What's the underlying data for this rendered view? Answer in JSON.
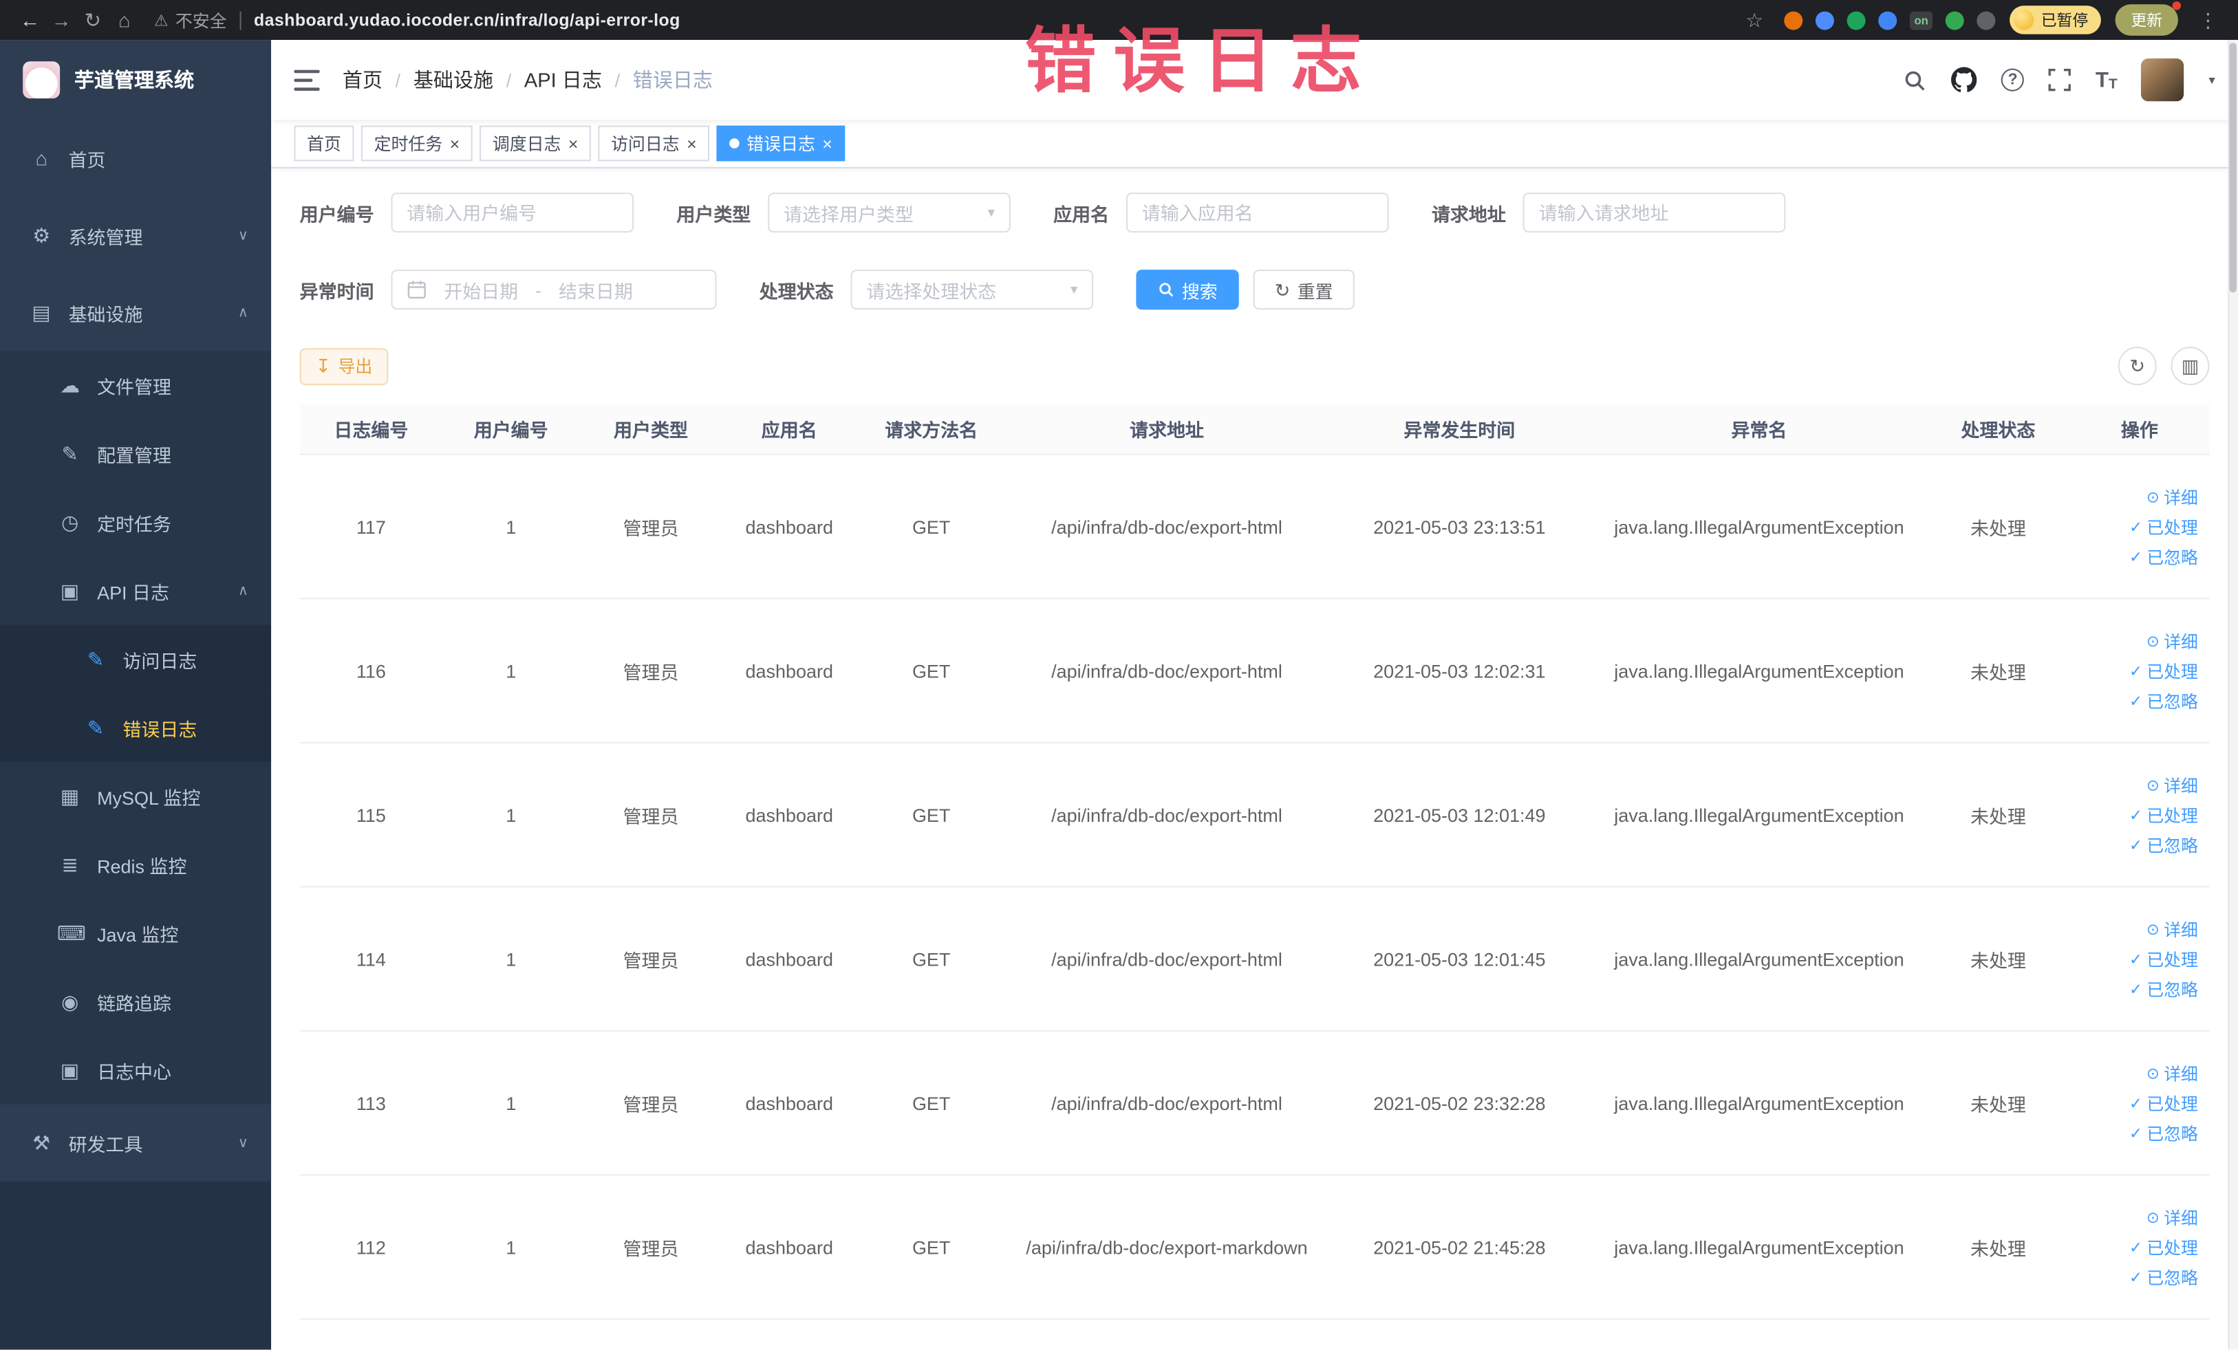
{
  "browser": {
    "security_label": "不安全",
    "url": "dashboard.yudao.iocoder.cn/infra/log/api-error-log",
    "paused_badge": "已暂停",
    "update_button": "更新",
    "extensions": [
      {
        "name": "extension-orange-icon",
        "color": "#e8710a"
      },
      {
        "name": "extension-blue-drop-icon",
        "color": "#4e8cff"
      },
      {
        "name": "extension-green-circle-icon",
        "color": "#1ea45c"
      },
      {
        "name": "extension-blue-grid-icon",
        "color": "#4285f4"
      },
      {
        "name": "extension-on-badge",
        "color": "#3c4043",
        "label": "on"
      },
      {
        "name": "extension-green-leaf-icon",
        "color": "#34a853"
      },
      {
        "name": "extension-pin-icon",
        "color": "#5f6368"
      }
    ]
  },
  "annotation": {
    "text": "错误日志",
    "color": "#ed4c67"
  },
  "theme": {
    "accent": "#409eff",
    "active_menu_text": "#ffd04b",
    "warning": "#e6a23c",
    "sidebar_bg": "#2e3d52"
  },
  "sidebar": {
    "logo_title": "芋道管理系统",
    "items": [
      {
        "label": "首页",
        "icon": "home-icon",
        "level": 0
      },
      {
        "label": "系统管理",
        "icon": "gear-icon",
        "level": 0,
        "chevron": "down"
      },
      {
        "label": "基础设施",
        "icon": "infrastructure-icon",
        "level": 0,
        "chevron": "up"
      },
      {
        "label": "文件管理",
        "icon": "file-icon",
        "level": 1
      },
      {
        "label": "配置管理",
        "icon": "config-icon",
        "level": 1
      },
      {
        "label": "定时任务",
        "icon": "timer-icon",
        "level": 1
      },
      {
        "label": "API 日志",
        "icon": "api-log-icon",
        "level": 1,
        "chevron": "up"
      },
      {
        "label": "访问日志",
        "icon": "access-log-icon",
        "level": 2,
        "icon_color": "#409eff"
      },
      {
        "label": "错误日志",
        "icon": "error-log-icon",
        "level": 2,
        "icon_color": "#409eff",
        "active": true
      },
      {
        "label": "MySQL 监控",
        "icon": "mysql-icon",
        "level": 1
      },
      {
        "label": "Redis 监控",
        "icon": "redis-icon",
        "level": 1
      },
      {
        "label": "Java 监控",
        "icon": "java-icon",
        "level": 1
      },
      {
        "label": "链路追踪",
        "icon": "trace-icon",
        "level": 1
      },
      {
        "label": "日志中心",
        "icon": "log-center-icon",
        "level": 1
      },
      {
        "label": "研发工具",
        "icon": "devtools-icon",
        "level": 0,
        "chevron": "down"
      }
    ]
  },
  "header": {
    "breadcrumb": [
      {
        "label": "首页"
      },
      {
        "label": "基础设施"
      },
      {
        "label": "API 日志"
      },
      {
        "label": "错误日志",
        "current": true
      }
    ]
  },
  "tabs": [
    {
      "label": "首页",
      "closable": false,
      "active": false
    },
    {
      "label": "定时任务",
      "closable": true,
      "active": false
    },
    {
      "label": "调度日志",
      "closable": true,
      "active": false
    },
    {
      "label": "访问日志",
      "closable": true,
      "active": false
    },
    {
      "label": "错误日志",
      "closable": true,
      "active": true
    }
  ],
  "filters": {
    "user_id": {
      "label": "用户编号",
      "placeholder": "请输入用户编号"
    },
    "user_type": {
      "label": "用户类型",
      "placeholder": "请选择用户类型"
    },
    "app_name": {
      "label": "应用名",
      "placeholder": "请输入应用名"
    },
    "request_url": {
      "label": "请求地址",
      "placeholder": "请输入请求地址"
    },
    "exception_time": {
      "label": "异常时间",
      "start_placeholder": "开始日期",
      "separator": "-",
      "end_placeholder": "结束日期"
    },
    "process_status": {
      "label": "处理状态",
      "placeholder": "请选择处理状态"
    },
    "search_button": "搜索",
    "reset_button": "重置"
  },
  "toolbar": {
    "export_label": "导出"
  },
  "table": {
    "columns": [
      "日志编号",
      "用户编号",
      "用户类型",
      "应用名",
      "请求方法名",
      "请求地址",
      "异常发生时间",
      "异常名",
      "处理状态",
      "操作"
    ],
    "action_labels": {
      "detail": "详细",
      "processed": "已处理",
      "ignored": "已忽略"
    },
    "rows": [
      {
        "id": "117",
        "user_id": "1",
        "user_type": "管理员",
        "app": "dashboard",
        "method": "GET",
        "url": "/api/infra/db-doc/export-html",
        "time": "2021-05-03 23:13:51",
        "exception": "java.lang.IllegalArgumentException",
        "status": "未处理"
      },
      {
        "id": "116",
        "user_id": "1",
        "user_type": "管理员",
        "app": "dashboard",
        "method": "GET",
        "url": "/api/infra/db-doc/export-html",
        "time": "2021-05-03 12:02:31",
        "exception": "java.lang.IllegalArgumentException",
        "status": "未处理"
      },
      {
        "id": "115",
        "user_id": "1",
        "user_type": "管理员",
        "app": "dashboard",
        "method": "GET",
        "url": "/api/infra/db-doc/export-html",
        "time": "2021-05-03 12:01:49",
        "exception": "java.lang.IllegalArgumentException",
        "status": "未处理"
      },
      {
        "id": "114",
        "user_id": "1",
        "user_type": "管理员",
        "app": "dashboard",
        "method": "GET",
        "url": "/api/infra/db-doc/export-html",
        "time": "2021-05-03 12:01:45",
        "exception": "java.lang.IllegalArgumentException",
        "status": "未处理"
      },
      {
        "id": "113",
        "user_id": "1",
        "user_type": "管理员",
        "app": "dashboard",
        "method": "GET",
        "url": "/api/infra/db-doc/export-html",
        "time": "2021-05-02 23:32:28",
        "exception": "java.lang.IllegalArgumentException",
        "status": "未处理"
      },
      {
        "id": "112",
        "user_id": "1",
        "user_type": "管理员",
        "app": "dashboard",
        "method": "GET",
        "url": "/api/infra/db-doc/export-markdown",
        "time": "2021-05-02 21:45:28",
        "exception": "java.lang.IllegalArgumentException",
        "status": "未处理"
      }
    ]
  },
  "icons": {
    "back-icon": "←",
    "forward-icon": "→",
    "reload-icon": "↻",
    "browser-home-icon": "⌂",
    "warning-icon": "⚠",
    "star-icon": "☆",
    "overflow-menu-icon": "⋮",
    "help-icon": "?",
    "font-size-icon": "T",
    "caret-down-icon": "▾",
    "select-caret-icon": "▾",
    "chevron-up-icon": "∧",
    "chevron-down-icon": "∨",
    "close-icon": "×",
    "breadcrumb-separator": "/",
    "home-icon": "⌂",
    "gear-icon": "⚙",
    "infrastructure-icon": "▤",
    "file-icon": "☁",
    "config-icon": "✎",
    "timer-icon": "◷",
    "api-log-icon": "▣",
    "access-log-icon": "✎",
    "error-log-icon": "✎",
    "mysql-icon": "▦",
    "redis-icon": "≣",
    "java-icon": "⌨",
    "trace-icon": "◉",
    "log-center-icon": "▣",
    "devtools-icon": "⚒",
    "download-icon": "↧",
    "reset-icon": "↻",
    "refresh-icon": "↻",
    "columns-icon": "▥",
    "detail-icon": "⊙",
    "check-icon": "✓"
  }
}
